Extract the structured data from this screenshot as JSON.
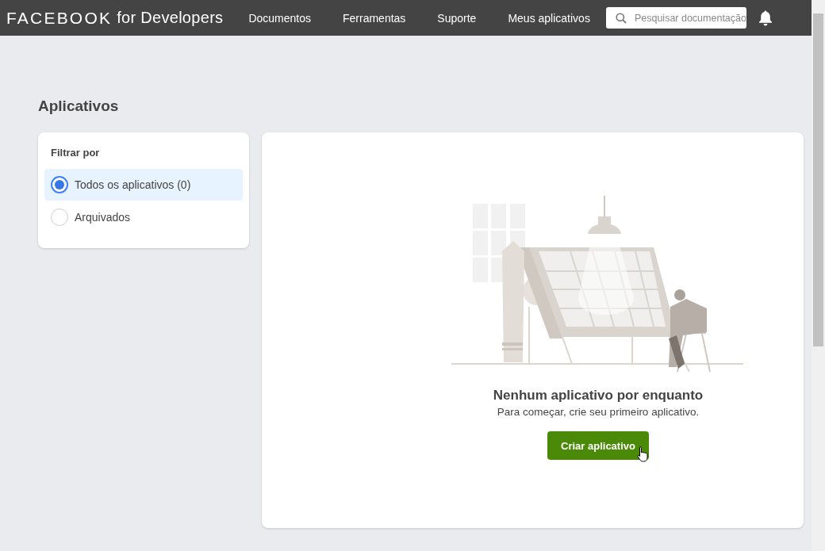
{
  "header": {
    "brand": "FACEBOOK",
    "brand_suffix": "for Developers",
    "nav": [
      {
        "label": "Documentos"
      },
      {
        "label": "Ferramentas"
      },
      {
        "label": "Suporte"
      },
      {
        "label": "Meus aplicativos"
      }
    ],
    "search": {
      "placeholder": "Pesquisar documentação"
    }
  },
  "page_title": "Aplicativos",
  "filter": {
    "title": "Filtrar por",
    "options": [
      {
        "label": "Todos os aplicativos (0)",
        "selected": true
      },
      {
        "label": "Arquivados",
        "selected": false
      }
    ]
  },
  "empty_state": {
    "heading": "Nenhum aplicativo por enquanto",
    "message": "Para começar, crie seu primeiro aplicativo.",
    "button": "Criar aplicativo"
  }
}
